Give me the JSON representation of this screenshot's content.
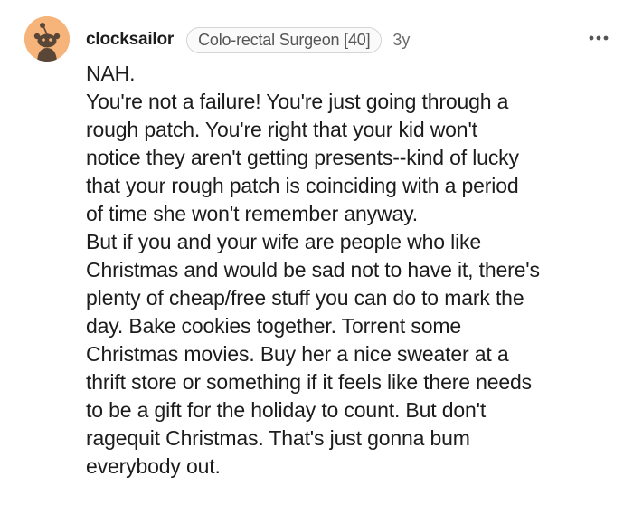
{
  "comment": {
    "author": "clocksailor",
    "flair": "Colo-rectal Surgeon [40]",
    "age": "3y",
    "avatar_icon": "snoo-avatar-icon",
    "avatar_color": "#f6b47a",
    "more_icon": "more-options-icon",
    "paragraphs": [
      {
        "lines": [
          "NAH."
        ]
      },
      {
        "lines": [
          "You're not a failure! You're just going through a",
          "rough patch. You're right that your kid won't",
          "notice they aren't getting presents--kind of lucky",
          "that your rough patch is coinciding with a period",
          "of time she won't remember anyway."
        ]
      },
      {
        "lines": [
          "But if you and your wife are people who like",
          "Christmas and would be sad not to have it, there's",
          "plenty of cheap/free stuff you can do to mark the",
          "day. Bake cookies together. Torrent some",
          "Christmas movies. Buy her a nice sweater at a",
          "thrift store or something if it feels like there needs",
          "to be a gift for the holiday to count. But don't",
          "ragequit Christmas. That's just gonna bum",
          "everybody out."
        ]
      }
    ]
  }
}
